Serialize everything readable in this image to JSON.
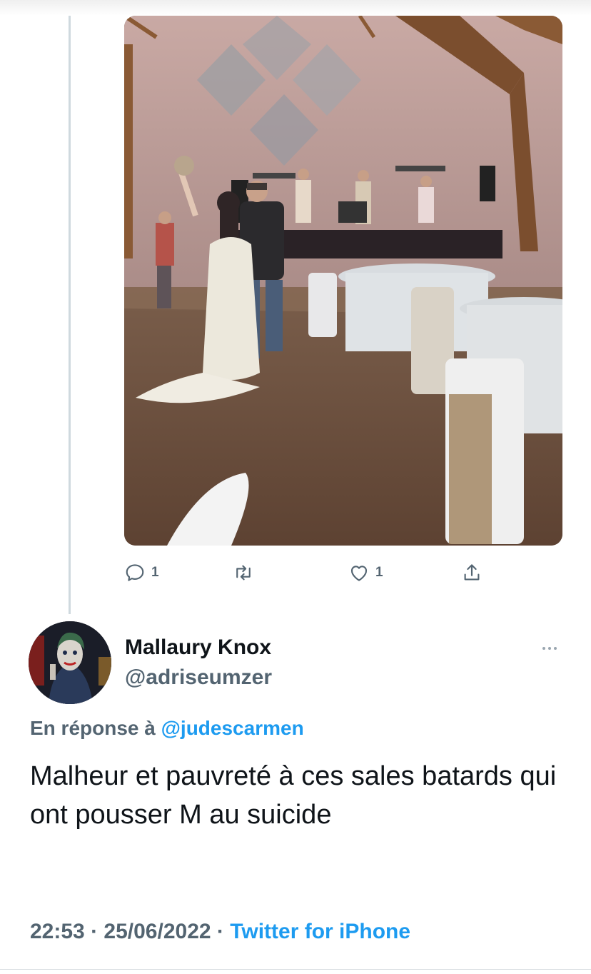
{
  "tweet_above": {
    "reply_count": "1",
    "like_count": "1",
    "icons": [
      "reply-icon",
      "retweet-icon",
      "like-icon",
      "share-icon"
    ]
  },
  "reply_tweet": {
    "display_name": "Mallaury Knox",
    "handle": "@adriseumzer",
    "reply_prefix": "En réponse à",
    "reply_mention": "@judescarmen",
    "text": "Malheur et pauvreté à ces sales batards qui ont pousser M au suicide",
    "time": "22:53",
    "separator": "·",
    "date": "25/06/2022",
    "source": "Twitter for iPhone"
  },
  "colors": {
    "text": "#0f1419",
    "secondary": "#536471",
    "link": "#1d9bf0",
    "thread_line": "#cfd9de"
  }
}
